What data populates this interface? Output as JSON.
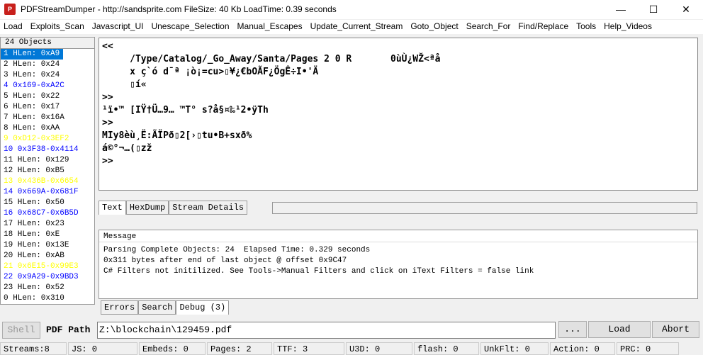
{
  "window": {
    "title": "PDFStreamDumper  - http://sandsprite.com     FileSize: 40 Kb   LoadTime: 0.39 seconds",
    "icon": "pdf-app-icon"
  },
  "menu": [
    "Load",
    "Exploits_Scan",
    "Javascript_UI",
    "Unescape_Selection",
    "Manual_Escapes",
    "Update_Current_Stream",
    "Goto_Object",
    "Search_For",
    "Find/Replace",
    "Tools",
    "Help_Videos"
  ],
  "objects": {
    "header": "24 Objects",
    "items": [
      {
        "label": "1 HLen: 0xA9",
        "color": "#000000",
        "selected": true
      },
      {
        "label": "2 HLen: 0x24",
        "color": "#000000"
      },
      {
        "label": "3 HLen: 0x24",
        "color": "#000000"
      },
      {
        "label": "4 0x169-0xA2C",
        "color": "#0000ff"
      },
      {
        "label": "5 HLen: 0x22",
        "color": "#000000"
      },
      {
        "label": "6 HLen: 0x17",
        "color": "#000000"
      },
      {
        "label": "7 HLen: 0x16A",
        "color": "#000000"
      },
      {
        "label": "8 HLen: 0xAA",
        "color": "#000000"
      },
      {
        "label": "9 0xD12-0x3EF2",
        "color": "#ffff00"
      },
      {
        "label": "10 0x3F38-0x4114",
        "color": "#0000ff"
      },
      {
        "label": "11 HLen: 0x129",
        "color": "#000000"
      },
      {
        "label": "12 HLen: 0xB5",
        "color": "#000000"
      },
      {
        "label": "13 0x436B-0x6654",
        "color": "#ffff00"
      },
      {
        "label": "14 0x669A-0x681F",
        "color": "#0000ff"
      },
      {
        "label": "15 HLen: 0x50",
        "color": "#000000"
      },
      {
        "label": "16 0x68C7-0x6B5D",
        "color": "#0000ff"
      },
      {
        "label": "17 HLen: 0x23",
        "color": "#000000"
      },
      {
        "label": "18 HLen: 0xE",
        "color": "#000000"
      },
      {
        "label": "19 HLen: 0x13E",
        "color": "#000000"
      },
      {
        "label": "20 HLen: 0xAB",
        "color": "#000000"
      },
      {
        "label": "21 0x6E15-0x99E3",
        "color": "#ffff00"
      },
      {
        "label": "22 0x9A29-0x9BD3",
        "color": "#0000ff"
      },
      {
        "label": "23 HLen: 0x52",
        "color": "#000000"
      },
      {
        "label": "0 HLen: 0x310",
        "color": "#000000"
      }
    ]
  },
  "content": "<<\n     /Type/Catalog/_Go_Away/Santa/Pages 2 0 R       0ùÙ¿WŽ<ªå\n     x ç`ó d¯ª ¡ò¡=cu>▯¥¿€bOÃF¿ÖgÊ÷I•'Ä\n     ▯í«\n>>\n¹ï•™ [IŸ†Ü…9… ™T° s?å§¤‰¹2•ÿTh\n>>\nMIy8èù¸Ë:ÃÏPð▯2[›▯tu•B+sxð%\ná©°¬…(▯zž\n>>",
  "view_tabs": [
    "Text",
    "HexDump",
    "Stream Details"
  ],
  "message": {
    "header": "Message",
    "lines": [
      "Parsing Complete Objects: 24  Elapsed Time: 0.329 seconds",
      "0x311 bytes after end of last object @ offset 0x9C47",
      "C# Filters not initilized. See Tools->Manual Filters and click on iText Filters = false link"
    ]
  },
  "bottom_tabs": [
    "Errors",
    "Search",
    "Debug (3)"
  ],
  "path": {
    "shell": "Shell",
    "label": "PDF Path",
    "value": "Z:\\blockchain\\129459.pdf",
    "browse": "...",
    "load": "Load",
    "abort": "Abort"
  },
  "status": [
    "Streams:8",
    "JS: 0",
    "Embeds: 0",
    "Pages: 2",
    "TTF: 3",
    "U3D: 0",
    "flash: 0",
    "UnkFlt: 0",
    "Action: 0",
    "PRC: 0"
  ]
}
